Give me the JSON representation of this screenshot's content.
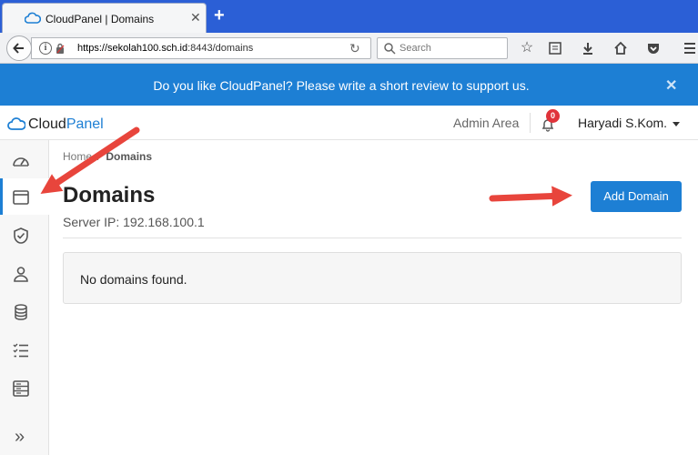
{
  "browser": {
    "tab_title": "CloudPanel | Domains",
    "tab_close": "✕",
    "new_tab": "+",
    "url_host": "https://sekolah100.sch.id",
    "url_path": ":8443/domains",
    "search_placeholder": "Search"
  },
  "banner": {
    "text": "Do you like CloudPanel? Please write a short review to support us.",
    "close": "✕"
  },
  "header": {
    "logo_main": "Cloud",
    "logo_accent": "Panel",
    "admin_area": "Admin Area",
    "notification_count": "0",
    "user_name": "Haryadi S.Kom."
  },
  "sidebar": {
    "items": [
      {
        "icon": "dashboard-icon"
      },
      {
        "icon": "domains-window-icon",
        "active": true
      },
      {
        "icon": "shield-check-icon"
      },
      {
        "icon": "user-icon"
      },
      {
        "icon": "database-icon"
      },
      {
        "icon": "checklist-icon"
      },
      {
        "icon": "server-list-icon"
      }
    ],
    "expand": "»"
  },
  "main": {
    "breadcrumb_home": "Home",
    "breadcrumb_sep": "/",
    "breadcrumb_current": "Domains",
    "title": "Domains",
    "server_ip": "Server IP: 192.168.100.1",
    "add_button": "Add Domain",
    "empty_message": "No domains found."
  },
  "colors": {
    "accent": "#1d7fd4",
    "tab_strip": "#2b5fd6",
    "badge": "#e0333a",
    "annotation_arrow": "#e8453c"
  }
}
